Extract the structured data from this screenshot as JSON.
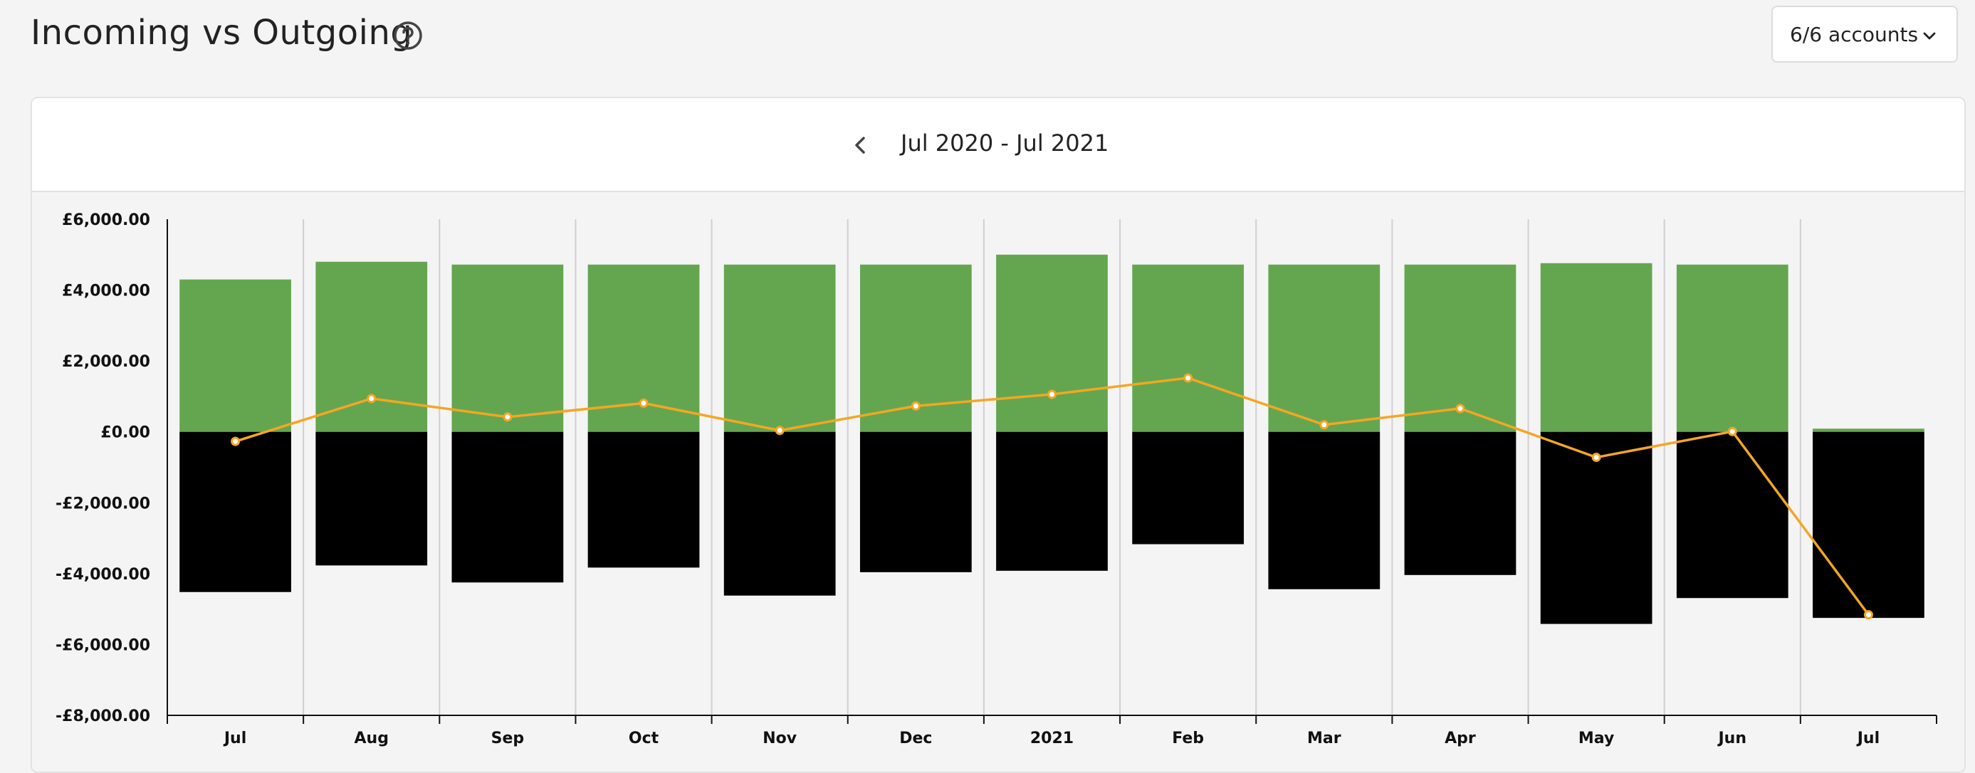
{
  "header": {
    "title": "Incoming vs Outgoing",
    "accounts_label": "6/6 accounts"
  },
  "period": {
    "label": "Jul 2020 - Jul 2021"
  },
  "colors": {
    "incoming": "#64a650",
    "outgoing": "#000000",
    "net": "#f5a623",
    "grid": "#cfcfcf",
    "axis": "#111111"
  },
  "icons": {
    "help": "question-circle-icon",
    "accounts_dropdown": "chevron-down-icon",
    "previous": "chevron-left-icon"
  },
  "chart_data": {
    "type": "bar",
    "title": "",
    "xlabel": "",
    "ylabel": "",
    "ylim": [
      -8000,
      6000
    ],
    "yticks": [
      6000,
      4000,
      2000,
      0,
      -2000,
      -4000,
      -6000,
      -8000
    ],
    "ytick_labels": [
      "£6,000.00",
      "£4,000.00",
      "£2,000.00",
      "£0.00",
      "-£2,000.00",
      "-£4,000.00",
      "-£6,000.00",
      "-£8,000.00"
    ],
    "categories": [
      "Jul",
      "Aug",
      "Sep",
      "Oct",
      "Nov",
      "Dec",
      "2021",
      "Feb",
      "Mar",
      "Apr",
      "May",
      "Jun",
      "Jul"
    ],
    "grid": true,
    "series": [
      {
        "type": "bar",
        "values": [
          4300,
          4800,
          4720,
          4720,
          4720,
          4720,
          5000,
          4720,
          4720,
          4720,
          4760,
          4720,
          90
        ]
      },
      {
        "type": "bar",
        "values": [
          -4520,
          -3770,
          -4250,
          -3830,
          -4620,
          -3960,
          -3920,
          -3170,
          -4440,
          -4040,
          -5420,
          -4690,
          -5250
        ]
      },
      {
        "type": "line",
        "values": [
          -270,
          940,
          420,
          810,
          40,
          730,
          1060,
          1520,
          200,
          660,
          -720,
          10,
          -5160
        ]
      }
    ]
  }
}
